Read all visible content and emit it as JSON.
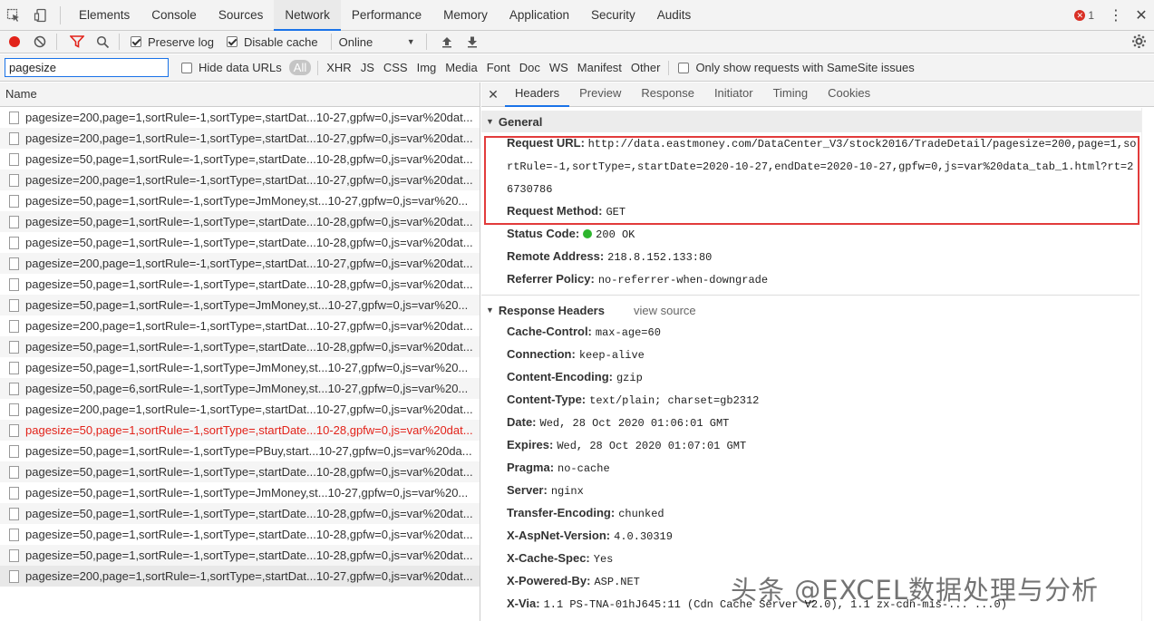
{
  "top_tabs": [
    "Elements",
    "Console",
    "Sources",
    "Network",
    "Performance",
    "Memory",
    "Application",
    "Security",
    "Audits"
  ],
  "active_tab": "Network",
  "error_count": "1",
  "toolbar": {
    "preserve_log": "Preserve log",
    "disable_cache": "Disable cache",
    "throttling": "Online"
  },
  "filter": {
    "value": "pagesize",
    "hide_data_urls": "Hide data URLs",
    "types": [
      "All",
      "XHR",
      "JS",
      "CSS",
      "Img",
      "Media",
      "Font",
      "Doc",
      "WS",
      "Manifest",
      "Other"
    ],
    "samesite": "Only show requests with SameSite issues"
  },
  "list": {
    "header": "Name",
    "rows": [
      "pagesize=200,page=1,sortRule=-1,sortType=,startDat...10-27,gpfw=0,js=var%20dat...",
      "pagesize=200,page=1,sortRule=-1,sortType=,startDat...10-27,gpfw=0,js=var%20dat...",
      "pagesize=50,page=1,sortRule=-1,sortType=,startDate...10-28,gpfw=0,js=var%20dat...",
      "pagesize=200,page=1,sortRule=-1,sortType=,startDat...10-27,gpfw=0,js=var%20dat...",
      "pagesize=50,page=1,sortRule=-1,sortType=JmMoney,st...10-27,gpfw=0,js=var%20...",
      "pagesize=50,page=1,sortRule=-1,sortType=,startDate...10-28,gpfw=0,js=var%20dat...",
      "pagesize=50,page=1,sortRule=-1,sortType=,startDate...10-28,gpfw=0,js=var%20dat...",
      "pagesize=200,page=1,sortRule=-1,sortType=,startDat...10-27,gpfw=0,js=var%20dat...",
      "pagesize=50,page=1,sortRule=-1,sortType=,startDate...10-28,gpfw=0,js=var%20dat...",
      "pagesize=50,page=1,sortRule=-1,sortType=JmMoney,st...10-27,gpfw=0,js=var%20...",
      "pagesize=200,page=1,sortRule=-1,sortType=,startDat...10-27,gpfw=0,js=var%20dat...",
      "pagesize=50,page=1,sortRule=-1,sortType=,startDate...10-28,gpfw=0,js=var%20dat...",
      "pagesize=50,page=1,sortRule=-1,sortType=JmMoney,st...10-27,gpfw=0,js=var%20...",
      "pagesize=50,page=6,sortRule=-1,sortType=JmMoney,st...10-27,gpfw=0,js=var%20...",
      "pagesize=200,page=1,sortRule=-1,sortType=,startDat...10-27,gpfw=0,js=var%20dat...",
      "pagesize=50,page=1,sortRule=-1,sortType=,startDate...10-28,gpfw=0,js=var%20dat...",
      "pagesize=50,page=1,sortRule=-1,sortType=PBuy,start...10-27,gpfw=0,js=var%20da...",
      "pagesize=50,page=1,sortRule=-1,sortType=,startDate...10-28,gpfw=0,js=var%20dat...",
      "pagesize=50,page=1,sortRule=-1,sortType=JmMoney,st...10-27,gpfw=0,js=var%20...",
      "pagesize=50,page=1,sortRule=-1,sortType=,startDate...10-28,gpfw=0,js=var%20dat...",
      "pagesize=50,page=1,sortRule=-1,sortType=,startDate...10-28,gpfw=0,js=var%20dat...",
      "pagesize=50,page=1,sortRule=-1,sortType=,startDate...10-28,gpfw=0,js=var%20dat...",
      "pagesize=200,page=1,sortRule=-1,sortType=,startDat...10-27,gpfw=0,js=var%20dat..."
    ],
    "error_row_index": 15,
    "selected_row_index": 22
  },
  "detail": {
    "tabs": [
      "Headers",
      "Preview",
      "Response",
      "Initiator",
      "Timing",
      "Cookies"
    ],
    "active": "Headers",
    "general": {
      "title": "General",
      "request_url_label": "Request URL:",
      "request_url": "http://data.eastmoney.com/DataCenter_V3/stock2016/TradeDetail/pagesize=200,page=1,sortRule=-1,sortType=,startDate=2020-10-27,endDate=2020-10-27,gpfw=0,js=var%20data_tab_1.html?rt=26730786",
      "request_method_label": "Request Method:",
      "request_method": "GET",
      "status_code_label": "Status Code:",
      "status_code": "200 OK",
      "remote_address_label": "Remote Address:",
      "remote_address": "218.8.152.133:80",
      "referrer_policy_label": "Referrer Policy:",
      "referrer_policy": "no-referrer-when-downgrade"
    },
    "response_headers": {
      "title": "Response Headers",
      "view_source": "view source",
      "items": [
        {
          "k": "Cache-Control:",
          "v": "max-age=60"
        },
        {
          "k": "Connection:",
          "v": "keep-alive"
        },
        {
          "k": "Content-Encoding:",
          "v": "gzip"
        },
        {
          "k": "Content-Type:",
          "v": "text/plain; charset=gb2312"
        },
        {
          "k": "Date:",
          "v": "Wed, 28 Oct 2020 01:06:01 GMT"
        },
        {
          "k": "Expires:",
          "v": "Wed, 28 Oct 2020 01:07:01 GMT"
        },
        {
          "k": "Pragma:",
          "v": "no-cache"
        },
        {
          "k": "Server:",
          "v": "nginx"
        },
        {
          "k": "Transfer-Encoding:",
          "v": "chunked"
        },
        {
          "k": "X-AspNet-Version:",
          "v": "4.0.30319"
        },
        {
          "k": "X-Cache-Spec:",
          "v": "Yes"
        },
        {
          "k": "X-Powered-By:",
          "v": "ASP.NET"
        },
        {
          "k": "X-Via:",
          "v": "1.1 PS-TNA-01hJ645:11 (Cdn Cache Server V2.0), 1.1 zx-cdn-mis-... ...0)"
        }
      ]
    }
  },
  "watermark": "头条 @EXCEL数据处理与分析",
  "colors": {
    "accent": "#1a73e8",
    "error": "#e2231a",
    "status_ok": "#2db52d",
    "highlight_box": "#e23b3b"
  }
}
